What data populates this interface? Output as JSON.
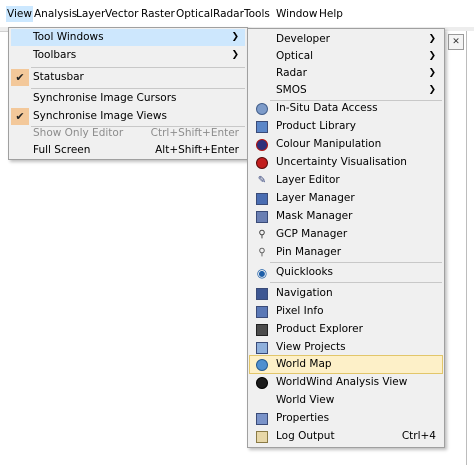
{
  "menubar": {
    "items": [
      "View",
      "Analysis",
      "Layer",
      "Vector",
      "Raster",
      "Optical",
      "Radar",
      "Tools",
      "Window",
      "Help"
    ]
  },
  "view_menu": {
    "tool_windows": "Tool Windows",
    "toolbars": "Toolbars",
    "statusbar": "Statusbar",
    "sync_cursors": "Synchronise Image Cursors",
    "sync_views": "Synchronise Image Views",
    "show_only_editor": "Show Only Editor",
    "show_only_editor_shortcut": "Ctrl+Shift+Enter",
    "full_screen": "Full Screen",
    "full_screen_shortcut": "Alt+Shift+Enter"
  },
  "tools_submenu": {
    "developer": "Developer",
    "optical": "Optical",
    "radar": "Radar",
    "smos": "SMOS",
    "insitu": "In-Situ Data Access",
    "product_library": "Product Library",
    "colour_manipulation": "Colour Manipulation",
    "uncertainty": "Uncertainty Visualisation",
    "layer_editor": "Layer Editor",
    "layer_manager": "Layer Manager",
    "mask_manager": "Mask Manager",
    "gcp_manager": "GCP Manager",
    "pin_manager": "Pin Manager",
    "quicklooks": "Quicklooks",
    "navigation": "Navigation",
    "pixel_info": "Pixel Info",
    "product_explorer": "Product Explorer",
    "view_projects": "View Projects",
    "world_map": "World Map",
    "worldwind_analysis": "WorldWind Analysis View",
    "world_view": "World View",
    "properties": "Properties",
    "log_output": "Log Output",
    "log_output_shortcut": "Ctrl+4"
  },
  "colors": {
    "highlight": "#cde7fd",
    "world_map_highlight": "#fdf0c8",
    "check_bg": "#f3c89a",
    "menu_bg": "#f0f0f0"
  }
}
